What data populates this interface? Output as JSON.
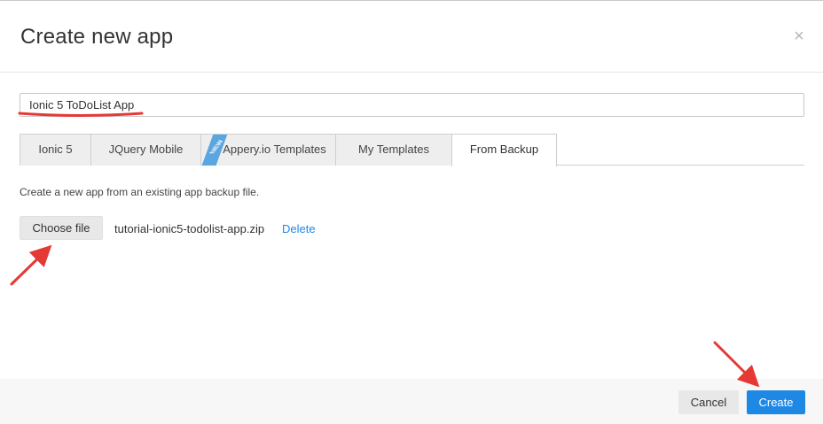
{
  "dialog": {
    "title": "Create new app",
    "close_glyph": "×"
  },
  "name_input": {
    "value": "Ionic 5 ToDoList App"
  },
  "tabs": [
    {
      "label": "Ionic 5"
    },
    {
      "label": "JQuery Mobile"
    },
    {
      "label": "Appery.io Templates",
      "ribbon": "NEW"
    },
    {
      "label": "My Templates"
    },
    {
      "label": "From Backup",
      "active": true
    }
  ],
  "backup": {
    "description": "Create a new app from an existing app backup file.",
    "choose_label": "Choose file",
    "file_name": "tutorial-ionic5-todolist-app.zip",
    "delete_label": "Delete"
  },
  "footer": {
    "cancel_label": "Cancel",
    "create_label": "Create"
  },
  "colors": {
    "primary": "#1e88e5",
    "annotation": "#e53935"
  }
}
